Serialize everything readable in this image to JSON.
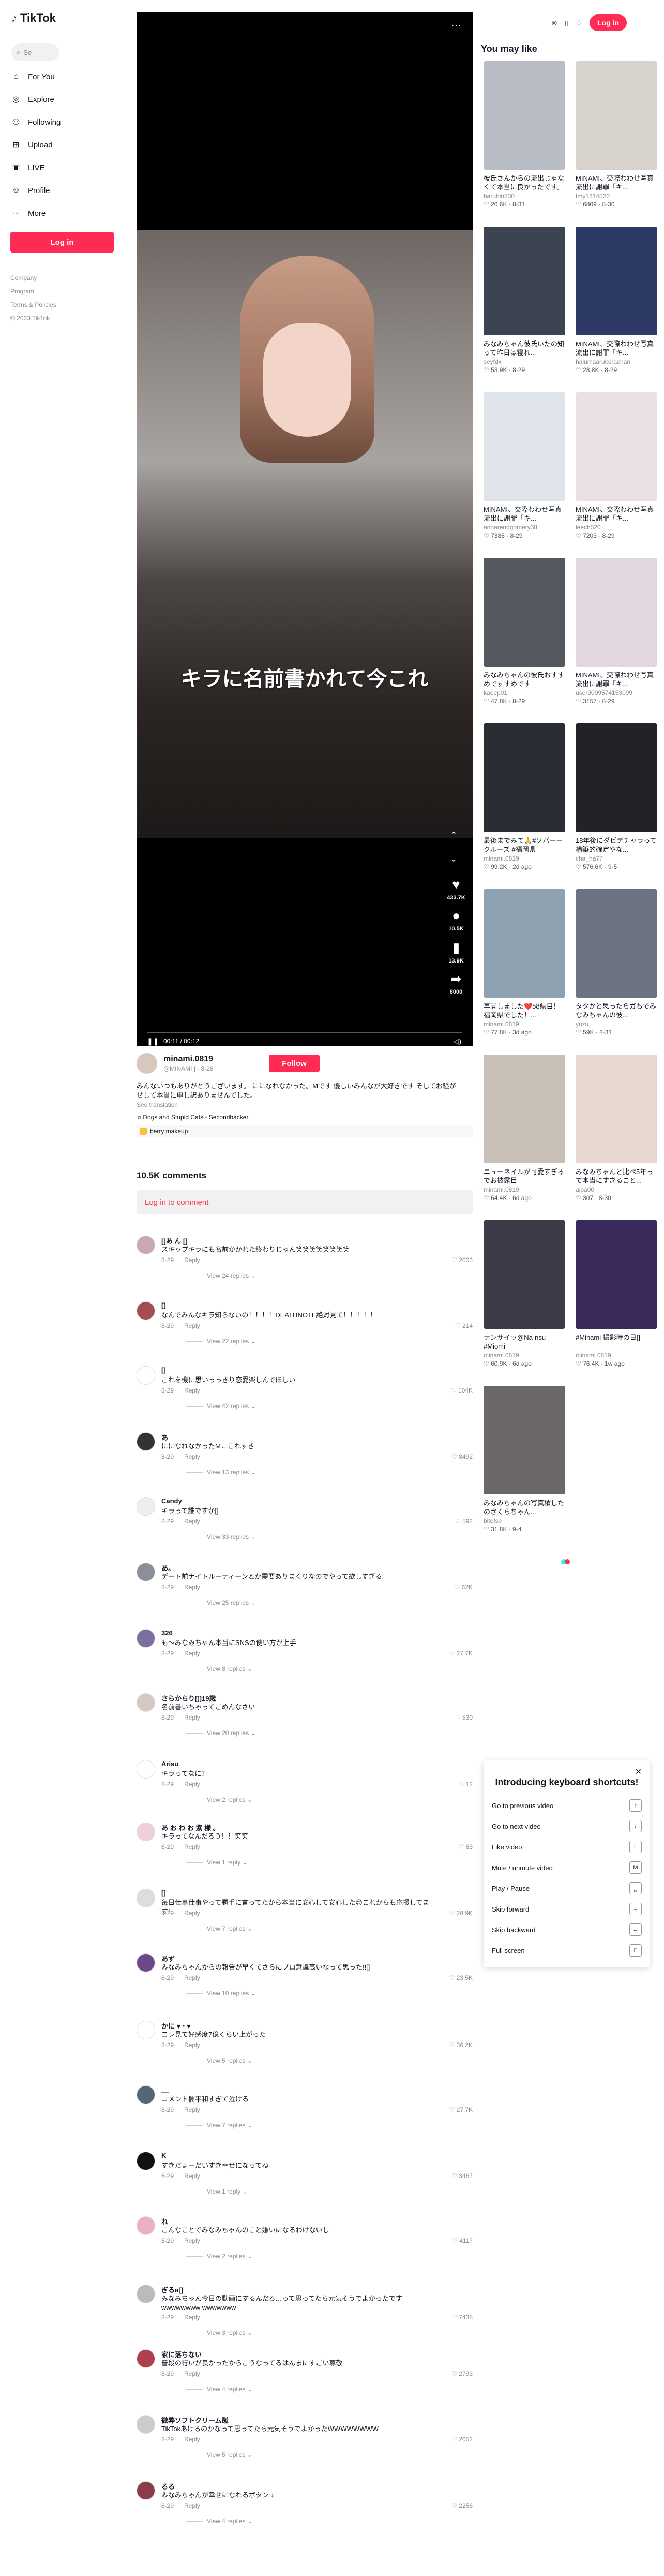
{
  "brand": {
    "name": "TikTok",
    "copyright": "© 2023 TikTok"
  },
  "search": {
    "placeholder": "Se"
  },
  "nav": [
    {
      "label": "For You",
      "icon": "home-icon"
    },
    {
      "label": "Explore",
      "icon": "compass-icon"
    },
    {
      "label": "Following",
      "icon": "users-icon"
    },
    {
      "label": "Upload",
      "icon": "upload-icon"
    },
    {
      "label": "LIVE",
      "icon": "live-icon"
    },
    {
      "label": "Profile",
      "icon": "user-icon"
    },
    {
      "label": "More",
      "icon": "more-icon"
    }
  ],
  "left_login": "Log in",
  "footer": [
    "Company",
    "Program",
    "Terms & Policies"
  ],
  "header": {
    "login": "Log in"
  },
  "video": {
    "caption": "キラに名前書かれて今これ",
    "time": "00:11 / 00:12",
    "likes": "433.7K",
    "comments": "10.5K",
    "saves": "13.9K",
    "shares": "8000"
  },
  "author": {
    "name": "minami.0819",
    "sub": "@MINAMI | · 8-28",
    "follow": "Follow",
    "desc": "みんないつもありがとうございます。 にになれなかった。Mです 優しいみんなが大好きです そしてお騒がせして本当に申し訳ありませんでした。",
    "see_translation": "See translation",
    "music": "♫ Dogs and Stupid Cats - Secondbacker",
    "effect": "berry makeup"
  },
  "comments_title": "10.5K comments",
  "comments_login": "Log in to comment",
  "comments": [
    {
      "user": "[]あ ん []",
      "text": "スキップキラにも名前かかれた終わりじゃん笑笑笑笑笑笑笑笑",
      "date": "8-29",
      "reply": "Reply",
      "likes": "2003",
      "replies": "View 24 replies"
    },
    {
      "user": "[]",
      "text": "なんでみんなキラ知らないの！！！！DEATHNOTE絶対見て！！！！！",
      "date": "8-29",
      "reply": "Reply",
      "likes": "214",
      "replies": "View 22 replies"
    },
    {
      "user": "[]",
      "text": "これを機に思いっっきり恋愛楽しんでほしい",
      "date": "8-29",
      "reply": "Reply",
      "likes": "104K",
      "replies": "View 42 replies"
    },
    {
      "user": "あ",
      "text": "にになれなかったM←これすき",
      "date": "8-29",
      "reply": "Reply",
      "likes": "8492",
      "replies": "View 13 replies"
    },
    {
      "user": "Candy",
      "text": "キラって誰ですか[]",
      "date": "8-29",
      "reply": "Reply",
      "likes": "592",
      "replies": "View 33 replies"
    },
    {
      "user": "あ。",
      "text": "デート前ナイトルーティーンとか需要ありまくりなのでやって欲しすぎる",
      "date": "8-29",
      "reply": "Reply",
      "likes": "62K",
      "replies": "View 25 replies"
    },
    {
      "user": "326___",
      "text": "も〜みなみちゃん本当にSNSの使い方が上手",
      "date": "8-29",
      "reply": "Reply",
      "likes": "27.7K",
      "replies": "View 8 replies"
    },
    {
      "user": "さらからり[]]19歳",
      "text": "名前書いちゃってごめんなさい",
      "date": "8-29",
      "reply": "Reply",
      "likes": "530",
      "replies": "View 20 replies"
    },
    {
      "user": "Arisu",
      "text": "キラってなに？",
      "date": "8-29",
      "reply": "Reply",
      "likes": "12",
      "replies": "View 2 replies"
    },
    {
      "user": "あ お わ お 紫 様 。",
      "text": "キラってなんだろう！！笑笑",
      "date": "8-29",
      "reply": "Reply",
      "likes": "63",
      "replies": "View 1 reply"
    },
    {
      "user": "[]",
      "text": "毎日仕事仕事やって勝手に言ってたから本当に安心して安心した😊これからも応援してます！",
      "date": "8-29",
      "reply": "Reply",
      "likes": "28.9K",
      "replies": "View 7 replies"
    },
    {
      "user": "あず",
      "text": "みなみちゃんからの報告が早くてさらにプロ意識高いなって思った!![]",
      "date": "8-29",
      "reply": "Reply",
      "likes": "23.5K",
      "replies": "View 10 replies"
    },
    {
      "user": "かに ♥ ‧ ♥",
      "text": "コレ見て好感度7億くらい上がった",
      "date": "8-29",
      "reply": "Reply",
      "likes": "36.2K",
      "replies": "View 5 replies"
    },
    {
      "user": "__",
      "text": "コメント欄平和すぎて泣ける",
      "date": "8-29",
      "reply": "Reply",
      "likes": "27.7K",
      "replies": "View 7 replies"
    },
    {
      "user": "K",
      "text": "すきだよーだいすき幸せになってね",
      "date": "8-29",
      "reply": "Reply",
      "likes": "3467",
      "replies": "View 1 reply"
    },
    {
      "user": "れ",
      "text": "こんなことでみなみちゃんのこと嫌いになるわけないし",
      "date": "8-29",
      "reply": "Reply",
      "likes": "4117",
      "replies": "View 2 replies"
    },
    {
      "user": "ぎるa[]",
      "text": "みなみちゃん今日の動画にするんだろ…って思ってたら元気そうでよかったですwwwwwwww wwwwwww",
      "date": "8-29",
      "reply": "Reply",
      "likes": "7438",
      "replies": "View 3 replies"
    },
    {
      "user": "家に落ちない",
      "text": "普段の行いが良かったからこうなってるはんまにすごい尊敬",
      "date": "8-29",
      "reply": "Reply",
      "likes": "2793",
      "replies": "View 4 replies"
    },
    {
      "user": "微弊ソフトクリーム蹴",
      "text": "TikTokあけるのかなって思ってたら元気そうでよかったWWWWWWWW",
      "date": "8-29",
      "reply": "Reply",
      "likes": "2052",
      "replies": "View 5 replies"
    },
    {
      "user": "るる",
      "text": "みなみちゃんが幸せになれるボタン ↓",
      "date": "8-29",
      "reply": "Reply",
      "likes": "2256",
      "replies": "View 4 replies"
    }
  ],
  "rec_title": "You may like",
  "recs": [
    {
      "desc": "彼氏さんからの流出じゃなくて本当に良かったです。",
      "author": "haruhin830",
      "likes": "20.6K",
      "date": "8-31",
      "color": "#b8bcc4"
    },
    {
      "desc": "MINAMI、交際わわせ写真流出に謝罪「キ...",
      "author": "tmy1314520",
      "likes": "6809",
      "date": "8-30",
      "color": "#d8d2cc"
    },
    {
      "desc": "みなみちゃん彼氏いたの知って昨日は寝れ...",
      "author": "seyfdx",
      "likes": "53.9K",
      "date": "8-29",
      "color": "#3c4452"
    },
    {
      "desc": "MINAMI、交際わわせ写真流出に謝罪「キ...",
      "author": "halumaarukurachan",
      "likes": "28.8K",
      "date": "8-29",
      "color": "#2d3a66"
    },
    {
      "desc": "MINAMI、交際わわせ写真流出に謝罪「キ...",
      "author": "annarendgomery38",
      "likes": "7385",
      "date": "8-29",
      "color": "#dfe3ea"
    },
    {
      "desc": "MINAMI、交際わわせ写真流出に謝罪「キ...",
      "author": "leech520",
      "likes": "7203",
      "date": "8-29",
      "color": "#e9dfe5"
    },
    {
      "desc": "みなみちゃんの彼氏おすすめですすめです",
      "author": "kaeep01",
      "likes": "47.8K",
      "date": "8-29",
      "color": "#545960"
    },
    {
      "desc": "MINAMI、交際わわせ写真流出に謝罪「キ...",
      "author": "user9009574153099",
      "likes": "3157",
      "date": "8-29",
      "color": "#e2d6e0"
    },
    {
      "desc": "最後までみて🙏#ソバーークルーズ #福岡県",
      "author": "minami.0819",
      "likes": "99.2K",
      "date": "2d ago",
      "color": "#2a2c33"
    },
    {
      "desc": "18年後にダビデチャラって構築的確定やな...",
      "author": "cha_ha77",
      "likes": "576.6K",
      "date": "9-5",
      "color": "#222228"
    },
    {
      "desc": "再開しました❤️58県目！福岡県でした！...",
      "author": "minami.0819",
      "likes": "77.8K",
      "date": "3d ago",
      "color": "#8fa2b2"
    },
    {
      "desc": "タタかと思ったらガちでみなみちゃんの彼...",
      "author": "yuzu",
      "likes": "59K",
      "date": "8-31",
      "color": "#6b7381"
    },
    {
      "desc": "ニューネイルが可愛すぎるでお披露目",
      "author": "minami.0819",
      "likes": "64.4K",
      "date": "6d ago",
      "color": "#c9c0b8"
    },
    {
      "desc": "みなみちゃんと比べ5年って本当にすぎること...",
      "author": "aipa00",
      "likes": "307",
      "date": "8-30",
      "color": "#e6d8cf"
    },
    {
      "desc": "テンサイッ@Na-nsu #Miomi",
      "author": "minami.0819",
      "likes": "60.9K",
      "date": "6d ago",
      "color": "#3e3a48"
    },
    {
      "desc": "#Minami 撮影時の日[]",
      "author": "minami.0819",
      "likes": "76.4K",
      "date": "1w ago",
      "color": "#3a2a5c"
    },
    {
      "desc": "みなみちゃんの写真積したのさくらちゃん...",
      "author": "bitefse",
      "likes": "31.8K",
      "date": "9-4",
      "color": "#6c6867"
    }
  ],
  "shortcuts": {
    "title": "Introducing keyboard shortcuts!",
    "items": [
      {
        "label": "Go to previous video",
        "key": "↑"
      },
      {
        "label": "Go to next video",
        "key": "↓"
      },
      {
        "label": "Like video",
        "key": "L"
      },
      {
        "label": "Mute / unmute video",
        "key": "M"
      },
      {
        "label": "Play / Pause",
        "key": "␣"
      },
      {
        "label": "Skip forward",
        "key": "→"
      },
      {
        "label": "Skip backward",
        "key": "←"
      },
      {
        "label": "Full screen",
        "key": "F"
      }
    ]
  }
}
